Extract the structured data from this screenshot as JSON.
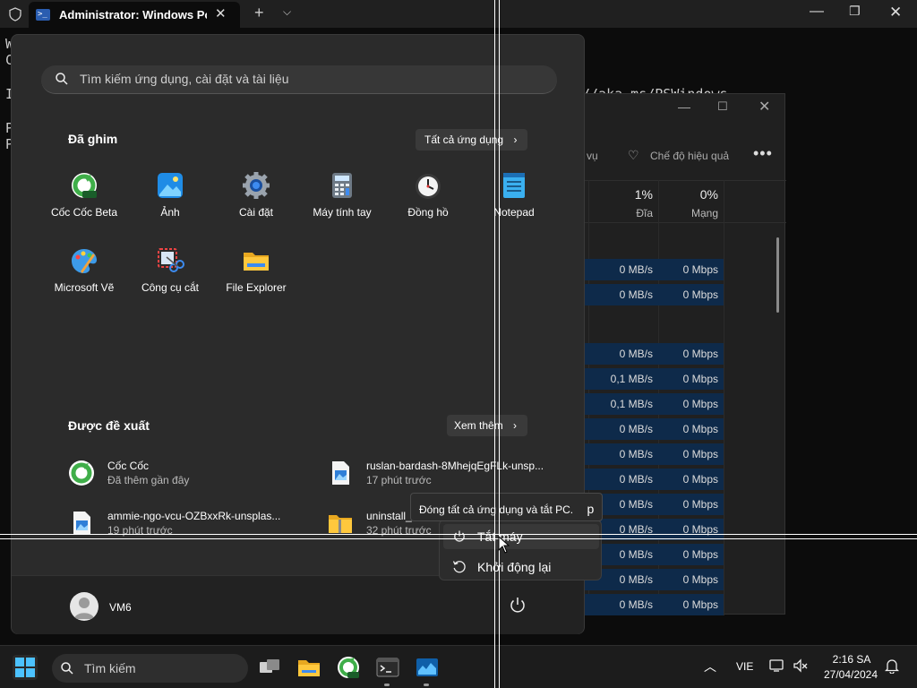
{
  "terminal": {
    "tab_title": "Administrator: Windows PowerShell",
    "lines": [
      {
        "text": "W"
      },
      {
        "text": "C"
      },
      {
        "text": "I"
      },
      {
        "text": "//aka.ms/PSWindows"
      },
      {
        "text": "P"
      },
      {
        "text": "P"
      }
    ]
  },
  "taskmgr": {
    "toolbar_partial": "ác vụ",
    "efficiency_label": "Chế độ hiệu quả",
    "cols": [
      {
        "pct": "1%",
        "label": "Đĩa"
      },
      {
        "pct": "0%",
        "label": "Mạng"
      }
    ],
    "rows": [
      {
        "disk": "0 MB/s",
        "net": "0 Mbps"
      },
      {
        "disk": "0 MB/s",
        "net": "0 Mbps"
      },
      {
        "disk": "0 MB/s",
        "net": "0 Mbps"
      },
      {
        "disk": "0,1 MB/s",
        "net": "0 Mbps"
      },
      {
        "disk": "0,1 MB/s",
        "net": "0 Mbps"
      },
      {
        "disk": "0 MB/s",
        "net": "0 Mbps"
      },
      {
        "disk": "0 MB/s",
        "net": "0 Mbps"
      },
      {
        "disk": "0 MB/s",
        "net": "0 Mbps"
      },
      {
        "disk": "0 MB/s",
        "net": "0 Mbps"
      },
      {
        "disk": "0 MB/s",
        "net": "0 Mbps"
      },
      {
        "disk": "0 MB/s",
        "net": "0 Mbps"
      },
      {
        "disk": "0 MB/s",
        "net": "0 Mbps"
      },
      {
        "disk": "0 MB/s",
        "net": "0 Mbps"
      },
      {
        "disk": "0 MB/s",
        "net": "0 Mbps"
      }
    ]
  },
  "start_menu": {
    "search_placeholder": "Tìm kiếm ứng dụng, cài đặt và tài liệu",
    "pinned_title": "Đã ghim",
    "all_apps_label": "Tất cả ứng dụng",
    "pinned": [
      {
        "label": "Cốc Cốc Beta",
        "icon": "coccoc-beta-icon"
      },
      {
        "label": "Ảnh",
        "icon": "photos-icon"
      },
      {
        "label": "Cài đặt",
        "icon": "settings-gear-icon"
      },
      {
        "label": "Máy tính tay",
        "icon": "calculator-icon"
      },
      {
        "label": "Đồng hồ",
        "icon": "clock-icon"
      },
      {
        "label": "Notepad",
        "icon": "notepad-icon"
      },
      {
        "label": "Microsoft Vẽ",
        "icon": "paint-icon"
      },
      {
        "label": "Công cụ cắt",
        "icon": "snipping-tool-icon"
      },
      {
        "label": "File Explorer",
        "icon": "folder-icon"
      }
    ],
    "recommended_title": "Được đề xuất",
    "more_label": "Xem thêm",
    "recommended": [
      {
        "name": "Cốc Cốc",
        "sub": "Đã thêm gần đây"
      },
      {
        "name": "ruslan-bardash-8MhejqEgFLk-unsp...",
        "sub": "17 phút trước"
      },
      {
        "name": "ammie-ngo-vcu-OZBxxRk-unsplas...",
        "sub": "19 phút trước"
      },
      {
        "name": "uninstall_",
        "sub": "32 phút trước"
      }
    ],
    "user_name": "VM6"
  },
  "power_menu": {
    "tooltip": "Đóng tất cả ứng dụng và tắt PC.",
    "tooltip_tail": "p",
    "shutdown": "Tắt máy",
    "restart": "Khởi động lại"
  },
  "taskbar": {
    "search_label": "Tìm kiếm",
    "language": "VIE",
    "time": "2:16 SA",
    "date": "27/04/2024"
  },
  "colors": {
    "accent": "#4cc2ff",
    "taskmgr_highlight": "#0e2a4a"
  }
}
